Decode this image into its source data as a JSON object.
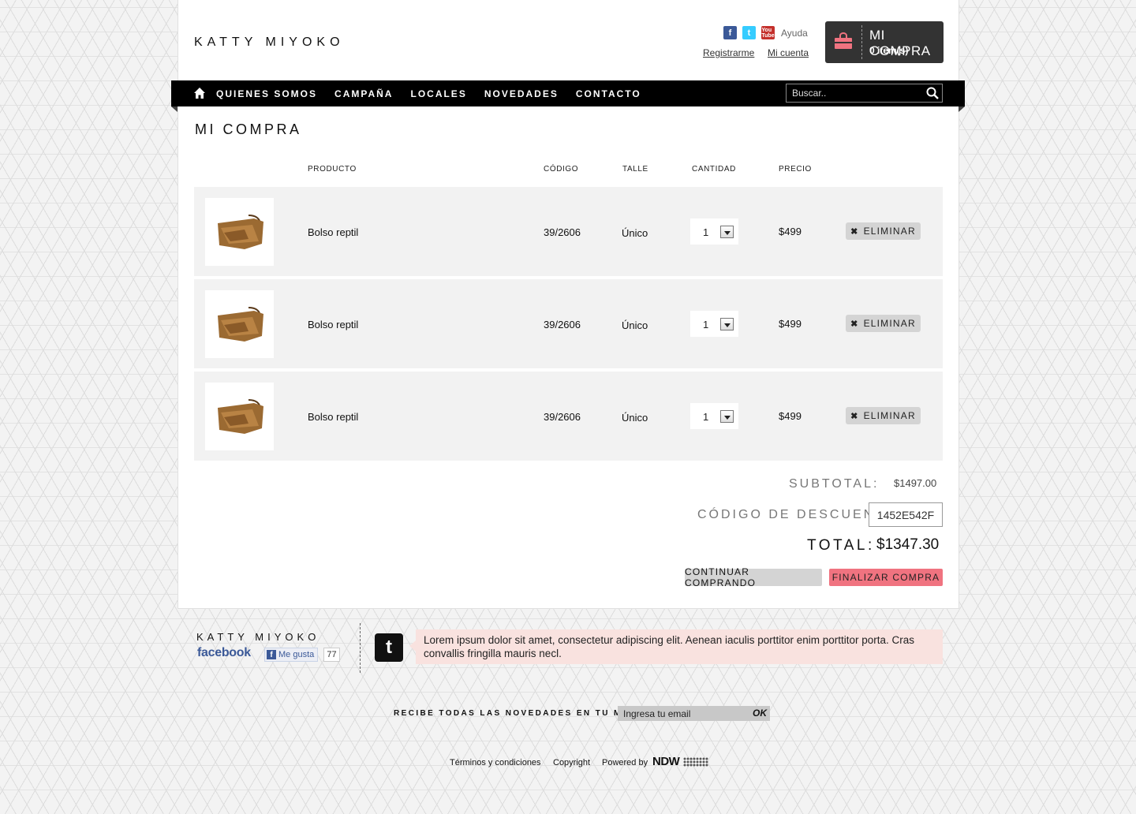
{
  "brand": {
    "logo_text": "KATTY MIYOKO"
  },
  "header": {
    "social_icons": [
      "facebook-icon",
      "twitter-icon",
      "youtube-icon"
    ],
    "help": "Ayuda",
    "register": "Registrarme",
    "account": "Mi cuenta",
    "cart": {
      "title": "MI COMPRA",
      "items": "0 item(s)",
      "accent": "#f07380"
    }
  },
  "nav": {
    "items": [
      "QUIENES SOMOS",
      "CAMPAÑA",
      "LOCALES",
      "NOVEDADES",
      "CONTACTO"
    ],
    "search_placeholder": "Buscar.."
  },
  "main": {
    "title": "MI COMPRA",
    "columns": [
      "PRODUCTO",
      "CÓDIGO",
      "TALLE",
      "CANTIDAD",
      "PRECIO"
    ],
    "rows": [
      {
        "product": "Bolso reptil",
        "code": "39/2606",
        "size": "Único",
        "qty": "1",
        "price": "$499",
        "delete": "ELIMINAR"
      },
      {
        "product": "Bolso reptil",
        "code": "39/2606",
        "size": "Único",
        "qty": "1",
        "price": "$499",
        "delete": "ELIMINAR"
      },
      {
        "product": "Bolso reptil",
        "code": "39/2606",
        "size": "Único",
        "qty": "1",
        "price": "$499",
        "delete": "ELIMINAR"
      }
    ],
    "subtotal_label": "SUBTOTAL:",
    "subtotal_value": "$1497.00",
    "discount_label": "CÓDIGO DE DESCUENTO:",
    "discount_value": "1452E542F",
    "total_label": "TOTAL:",
    "total_value": "$1347.30",
    "continue_button": "CONTINUAR COMPRANDO",
    "checkout_button": "FINALIZAR COMPRA"
  },
  "footer": {
    "logo_text": "KATTY MIYOKO",
    "facebook_word": "facebook",
    "like_label": "Me gusta",
    "like_count": "77",
    "tweet": "Lorem ipsum dolor sit amet, consectetur adipiscing elit. Aenean iaculis porttitor enim porttitor porta. Cras convallis fringilla mauris necl.",
    "newsletter_label": "RECIBE TODAS LAS NOVEDADES EN TU MAIL!",
    "newsletter_placeholder": "Ingresa tu email",
    "newsletter_ok": "OK",
    "terms": "Términos y condiciones",
    "copyright": "Copyright",
    "powered": "Powered by",
    "ndw": "NDW"
  }
}
